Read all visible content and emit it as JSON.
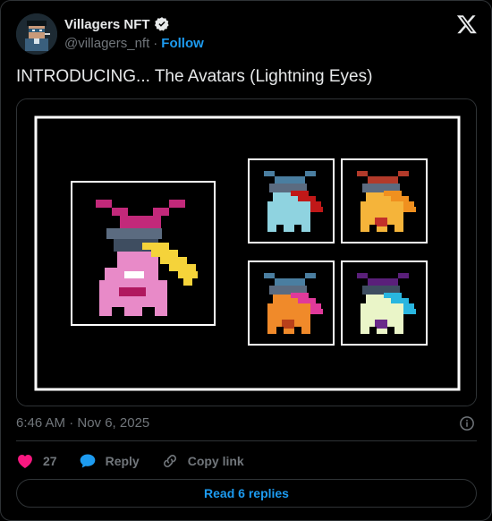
{
  "author": {
    "name": "Villagers NFT",
    "handle": "@villagers_nft",
    "separator": "·",
    "follow_label": "Follow",
    "verified_icon": "verified-badge-icon"
  },
  "tweet": {
    "text": "INTRODUCING... The Avatars (Lightning Eyes)",
    "timestamp": "6:46 AM · Nov 6, 2025"
  },
  "media": {
    "description_icon": "avatar-grid-artwork",
    "frame_color": "#ffffff",
    "background": "#000000"
  },
  "actions": {
    "likes_count": "27",
    "reply_label": "Reply",
    "copy_label": "Copy link"
  },
  "read_replies_label": "Read 6 replies",
  "colors": {
    "accent": "#1d9bf0",
    "like": "#f91880",
    "text_primary": "#e7e9ea",
    "text_secondary": "#71767b",
    "border": "#2f3336"
  }
}
